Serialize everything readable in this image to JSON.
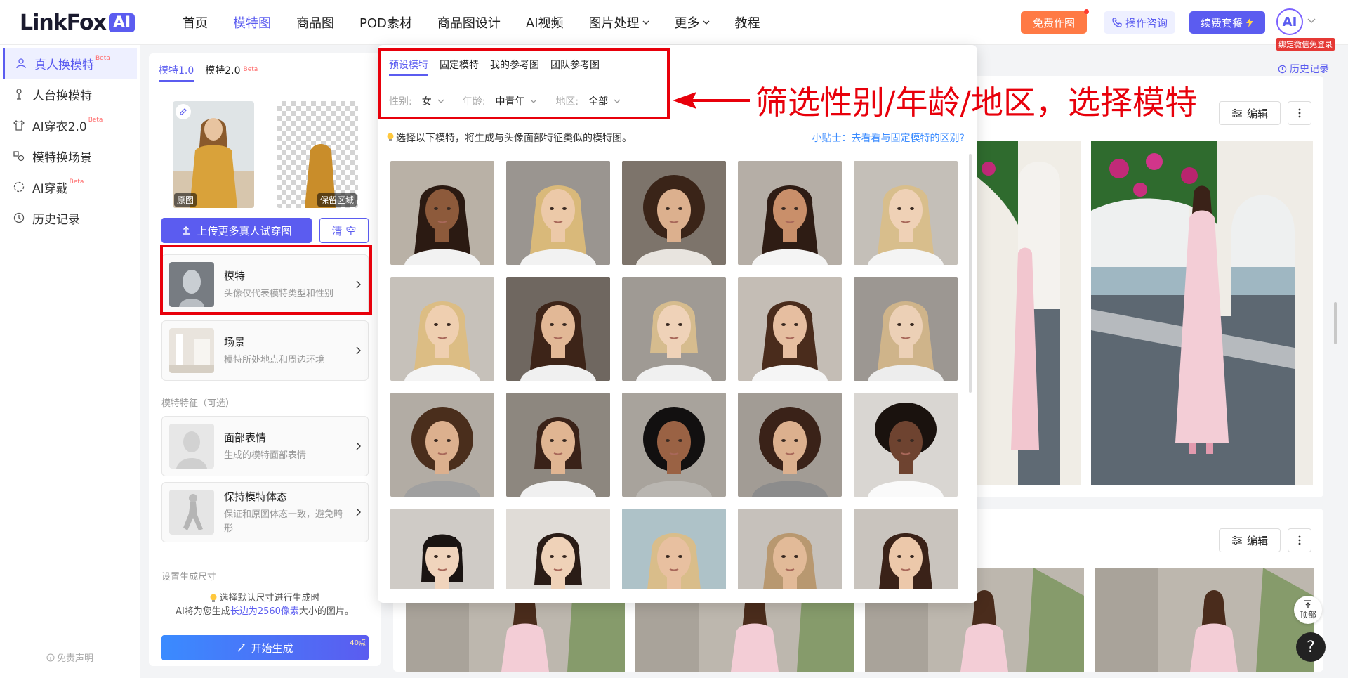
{
  "header": {
    "logo_text": "LinkFox",
    "logo_ai": "AI",
    "nav": [
      {
        "label": "首页",
        "active": false,
        "dropdown": false
      },
      {
        "label": "模特图",
        "active": true,
        "dropdown": false
      },
      {
        "label": "商品图",
        "active": false,
        "dropdown": false
      },
      {
        "label": "POD素材",
        "active": false,
        "dropdown": false
      },
      {
        "label": "商品图设计",
        "active": false,
        "dropdown": false
      },
      {
        "label": "AI视频",
        "active": false,
        "dropdown": false
      },
      {
        "label": "图片处理",
        "active": false,
        "dropdown": true
      },
      {
        "label": "更多",
        "active": false,
        "dropdown": true
      },
      {
        "label": "教程",
        "active": false,
        "dropdown": false
      }
    ],
    "free_btn": "免费作图",
    "consult_btn": "操作咨询",
    "renew_btn": "续费套餐",
    "avatar_text": "AI",
    "bind_tag": "绑定微信免登录"
  },
  "sidebar": {
    "items": [
      {
        "label": "真人换模特",
        "beta": "Beta",
        "active": true,
        "icon": "swap-person-icon"
      },
      {
        "label": "人台换模特",
        "beta": "",
        "active": false,
        "icon": "mannequin-icon"
      },
      {
        "label": "AI穿衣2.0",
        "beta": "Beta",
        "active": false,
        "icon": "shirt-icon"
      },
      {
        "label": "模特换场景",
        "beta": "",
        "active": false,
        "icon": "scene-icon"
      },
      {
        "label": "AI穿戴",
        "beta": "Beta",
        "active": false,
        "icon": "dashed-circle-icon"
      },
      {
        "label": "历史记录",
        "beta": "",
        "active": false,
        "icon": "clock-icon"
      }
    ],
    "disclaimer": "免责声明"
  },
  "panel": {
    "tabs": [
      {
        "label": "模特1.0",
        "beta": "",
        "active": true
      },
      {
        "label": "模特2.0",
        "beta": "Beta",
        "active": false
      }
    ],
    "original_label": "原图",
    "keep_label": "保留区域",
    "upload_btn": "上传更多真人试穿图",
    "clear_btn": "清 空",
    "model_card": {
      "title": "模特",
      "desc": "头像仅代表模特类型和性别"
    },
    "scene_card": {
      "title": "场景",
      "desc": "模特所处地点和周边环境"
    },
    "features_label": "模特特征（可选）",
    "face_card": {
      "title": "面部表情",
      "desc": "生成的模特面部表情"
    },
    "pose_card": {
      "title": "保持模特体态",
      "desc": "保证和原图体态一致，避免畸形"
    },
    "size_label": "设置生成尺寸",
    "tip_line1": "选择默认尺寸进行生成时",
    "tip_line2_pre": "AI将为您生成",
    "tip_line2_hl": "长边为2560像素",
    "tip_line2_post": "大小的图片。",
    "generate_btn": "开始生成",
    "generate_badge": "40点"
  },
  "popup": {
    "tabs": [
      {
        "label": "预设模特",
        "active": true
      },
      {
        "label": "固定模特",
        "active": false
      },
      {
        "label": "我的参考图",
        "active": false
      },
      {
        "label": "团队参考图",
        "active": false
      }
    ],
    "filters": [
      {
        "label": "性别:",
        "value": "女"
      },
      {
        "label": "年龄:",
        "value": "中青年"
      },
      {
        "label": "地区:",
        "value": "全部"
      }
    ],
    "hint": "选择以下模特，将生成与头像面部特征类似的模特图。",
    "hint_link": "小贴士：去看看与固定模特的区别?",
    "models": [
      {
        "skin": "#8d5a3b",
        "hair": "#2b1a12",
        "bg": "#b9b1a6",
        "shirt": "#f2f2f2",
        "style": "long"
      },
      {
        "skin": "#ecc9a8",
        "hair": "#d9b97a",
        "bg": "#9a9590",
        "shirt": "#f2f2f2",
        "style": "long"
      },
      {
        "skin": "#dcb08e",
        "hair": "#3a2418",
        "bg": "#7d746b",
        "shirt": "#e8e4df",
        "style": "curly"
      },
      {
        "skin": "#c98f6a",
        "hair": "#2e1c14",
        "bg": "#b5aea6",
        "shirt": "#f4f4f4",
        "style": "long"
      },
      {
        "skin": "#efd1b6",
        "hair": "#d8be8c",
        "bg": "#c4bfb8",
        "shirt": "#f4f4f4",
        "style": "long"
      },
      {
        "skin": "#efcfb0",
        "hair": "#dcbd84",
        "bg": "#c6c1ba",
        "shirt": "#f4f4f4",
        "style": "long"
      },
      {
        "skin": "#e2b896",
        "hair": "#3d2418",
        "bg": "#6f6760",
        "shirt": "#f0f0f0",
        "style": "long"
      },
      {
        "skin": "#efd2b8",
        "hair": "#d6bc8e",
        "bg": "#9f9a94",
        "shirt": "#f0f0f0",
        "style": "bob"
      },
      {
        "skin": "#e6bea0",
        "hair": "#4a2c1c",
        "bg": "#c4bdb5",
        "shirt": "#f5f5f5",
        "style": "long"
      },
      {
        "skin": "#ecd0b6",
        "hair": "#cfb48a",
        "bg": "#9c9792",
        "shirt": "#ededed",
        "style": "long"
      },
      {
        "skin": "#dcb08e",
        "hair": "#4a2e1c",
        "bg": "#b2aca4",
        "shirt": "#a0a0a0",
        "style": "curly"
      },
      {
        "skin": "#e0b592",
        "hair": "#3a2218",
        "bg": "#8d877f",
        "shirt": "#f0f0f0",
        "style": "bob"
      },
      {
        "skin": "#9a6244",
        "hair": "#121010",
        "bg": "#a8a39c",
        "shirt": "#b9b6b1",
        "style": "curly"
      },
      {
        "skin": "#dcb08e",
        "hair": "#3a2218",
        "bg": "#a29c95",
        "shirt": "#8c8c8c",
        "style": "curly"
      },
      {
        "skin": "#6e4330",
        "hair": "#1a120e",
        "bg": "#d9d6d2",
        "shirt": "#fafafa",
        "style": "afro"
      },
      {
        "skin": "#f0d4bc",
        "hair": "#1a1412",
        "bg": "#cfcbc6",
        "shirt": "#fafafa",
        "style": "bangs"
      },
      {
        "skin": "#efd2b8",
        "hair": "#2a1c16",
        "bg": "#e0dcd7",
        "shirt": "#fafafa",
        "style": "bob"
      },
      {
        "skin": "#e8c0a0",
        "hair": "#d9bd8a",
        "bg": "#aec2c8",
        "shirt": "#f0e8e0",
        "style": "long"
      },
      {
        "skin": "#e2ba98",
        "hair": "#b89870",
        "bg": "#c6c1bb",
        "shirt": "#1c1c1c",
        "style": "long"
      },
      {
        "skin": "#ecc8aa",
        "hair": "#3a2218",
        "bg": "#c9c4be",
        "shirt": "#f2f2f2",
        "style": "long"
      }
    ]
  },
  "results": {
    "history_btn": "历史记录",
    "edit_btn": "编辑",
    "top_btn": "顶部",
    "help_btn": "?"
  },
  "annotation": {
    "text": "筛选性别/年龄/地区，选择模特"
  },
  "colors": {
    "primary": "#5b5cf0",
    "orange": "#ff7a45",
    "annotation_red": "#e8000b"
  }
}
